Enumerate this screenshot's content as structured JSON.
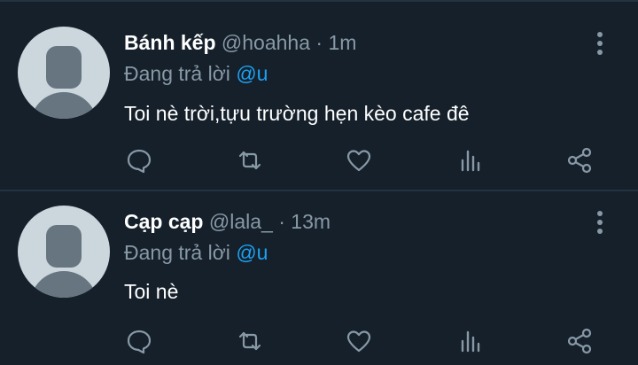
{
  "tweets": [
    {
      "name": "Bánh kếp",
      "handle": "@hoahha",
      "separator": "·",
      "time": "1m",
      "reply_prefix": "Đang trả lời",
      "reply_to": "@u",
      "text": "Toi nè trời,tựu trường hẹn kèo cafe đê"
    },
    {
      "name": "Cạp cạp",
      "handle": "@lala_",
      "separator": "·",
      "time": "13m",
      "reply_prefix": "Đang trả lời",
      "reply_to": "@u",
      "text": "Toi nè"
    }
  ],
  "icons": {
    "more": "more-vertical-icon",
    "reply": "comment-icon",
    "retweet": "retweet-icon",
    "like": "heart-icon",
    "stats": "analytics-icon",
    "share": "share-icon"
  },
  "colors": {
    "background": "#15202b",
    "muted": "#8899a6",
    "accent": "#1da1f2",
    "divider": "#253341"
  }
}
